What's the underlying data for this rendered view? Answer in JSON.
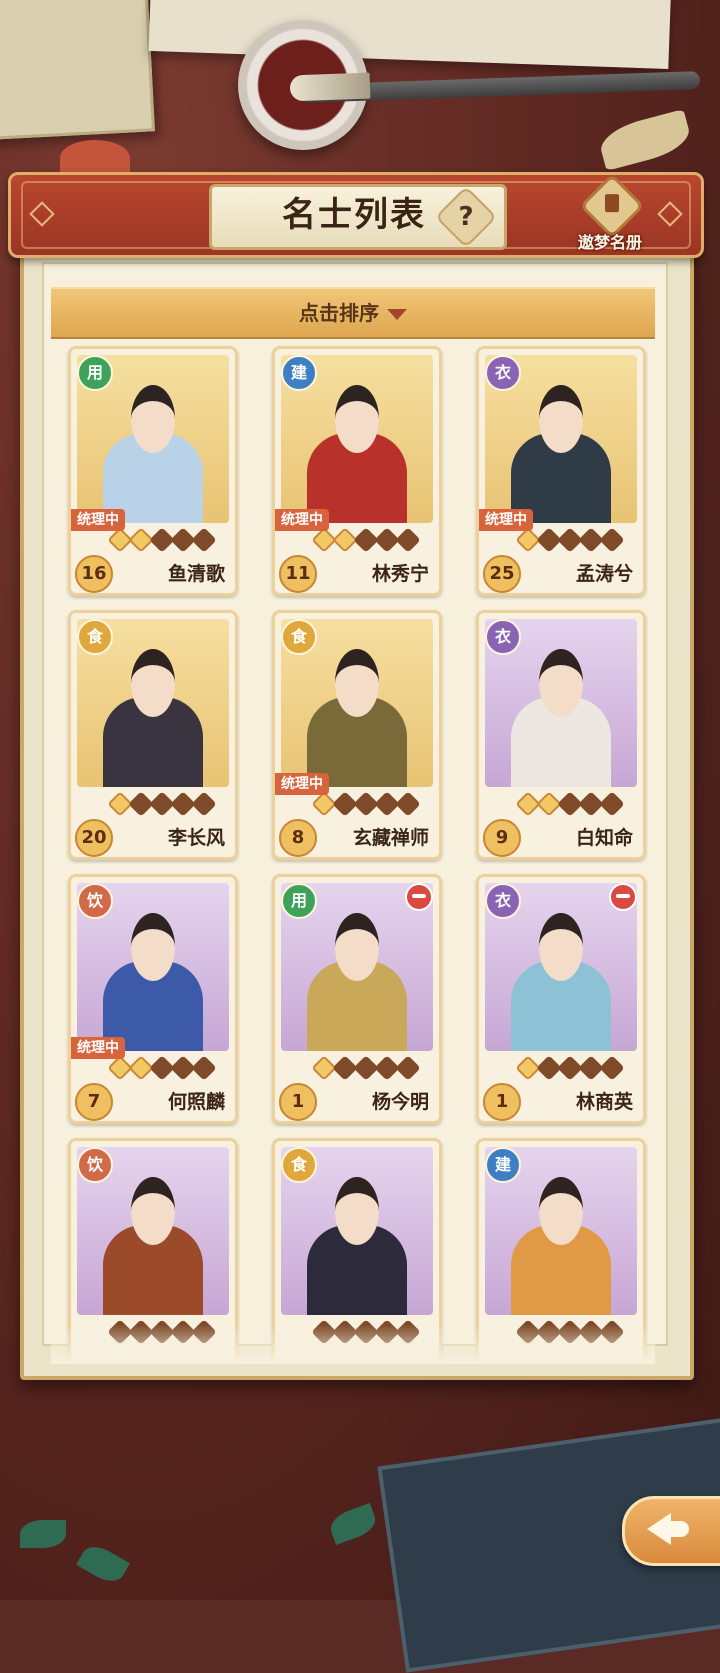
{
  "panel": {
    "title": "名士列表",
    "help_label": "?",
    "book_label": "遨梦名册",
    "sort_label": "点击排序"
  },
  "cards": [
    {
      "category": "用",
      "category_color": "#3fa25a",
      "bg": "gold",
      "status": "统理中",
      "stars": 2,
      "level": "16",
      "name": "鱼清歌",
      "red_icon": false,
      "body_color": "#b9d2e8"
    },
    {
      "category": "建",
      "category_color": "#3d7fc2",
      "bg": "gold",
      "status": "统理中",
      "stars": 2,
      "level": "11",
      "name": "林秀宁",
      "red_icon": false,
      "body_color": "#b8322b"
    },
    {
      "category": "衣",
      "category_color": "#8a63b4",
      "bg": "gold",
      "status": "统理中",
      "stars": 1,
      "level": "25",
      "name": "孟涛兮",
      "red_icon": false,
      "body_color": "#2f3b46"
    },
    {
      "category": "食",
      "category_color": "#e0a83c",
      "bg": "gold",
      "status": "",
      "stars": 1,
      "level": "20",
      "name": "李长风",
      "red_icon": false,
      "body_color": "#3a3340"
    },
    {
      "category": "食",
      "category_color": "#e0a83c",
      "bg": "gold",
      "status": "统理中",
      "stars": 1,
      "level": "8",
      "name": "玄藏禅师",
      "red_icon": false,
      "body_color": "#7a6a3a"
    },
    {
      "category": "衣",
      "category_color": "#8a63b4",
      "bg": "purple",
      "status": "",
      "stars": 2,
      "level": "9",
      "name": "白知命",
      "red_icon": false,
      "body_color": "#ece7e0"
    },
    {
      "category": "饮",
      "category_color": "#d06a48",
      "bg": "purple",
      "status": "统理中",
      "stars": 2,
      "level": "7",
      "name": "何照麟",
      "red_icon": false,
      "body_color": "#3c5aa8"
    },
    {
      "category": "用",
      "category_color": "#3fa25a",
      "bg": "purple",
      "status": "",
      "stars": 1,
      "level": "1",
      "name": "杨今明",
      "red_icon": true,
      "body_color": "#c9a85a"
    },
    {
      "category": "衣",
      "category_color": "#8a63b4",
      "bg": "purple",
      "status": "",
      "stars": 1,
      "level": "1",
      "name": "林商英",
      "red_icon": true,
      "body_color": "#8dc1d6"
    },
    {
      "category": "饮",
      "category_color": "#d06a48",
      "bg": "purple",
      "status": "",
      "stars": 0,
      "level": "",
      "name": "",
      "red_icon": false,
      "body_color": "#9b4a2a"
    },
    {
      "category": "食",
      "category_color": "#e0a83c",
      "bg": "purple",
      "status": "",
      "stars": 0,
      "level": "",
      "name": "",
      "red_icon": false,
      "body_color": "#2d2a3c"
    },
    {
      "category": "建",
      "category_color": "#3d7fc2",
      "bg": "purple",
      "status": "",
      "stars": 0,
      "level": "",
      "name": "",
      "red_icon": false,
      "body_color": "#e09a45"
    }
  ],
  "max_stars": 5
}
